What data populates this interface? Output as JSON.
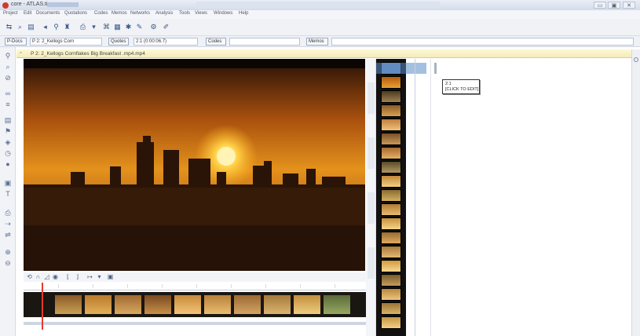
{
  "window": {
    "title": "core - ATLAS.ti",
    "minimize_label": "▭",
    "restore_label": "▣",
    "close_label": "✕"
  },
  "menu": [
    "Project",
    "Edit",
    "Documents",
    "Quotations",
    "Codes",
    "Memos",
    "Networks",
    "Analysis",
    "Tools",
    "Views",
    "Windows",
    "Help"
  ],
  "docbar": {
    "pdocs_label": "P-Docs",
    "document_value": "P 2: 2_Kellogs Corn",
    "quotes_label": "Quotes",
    "quote_value": "2:1 (0:00:06.7)",
    "codes_label": "Codes",
    "memos_label": "Memos"
  },
  "document": {
    "title": "P 2: 2_Kellogs Cornflakes Big Breakfast .mp4.mp4",
    "close_label": "×"
  },
  "quote_tooltip": {
    "line1": "2:1",
    "line2": "[CLICK TO EDIT]"
  },
  "colors": {
    "accent": "#3a5a8a",
    "playhead": "#e53b2a",
    "header_bg": "#f4ecb9"
  }
}
